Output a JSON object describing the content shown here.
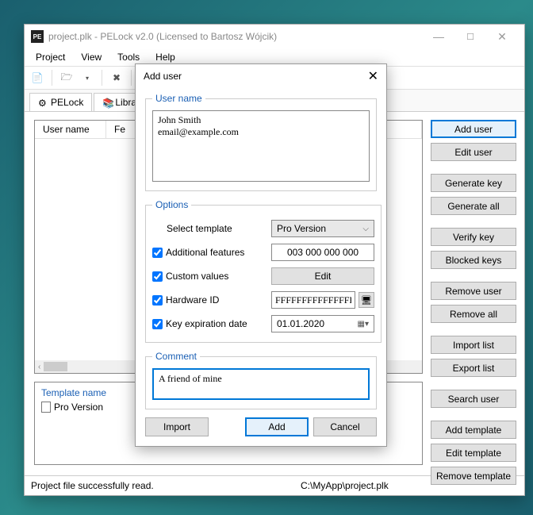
{
  "window": {
    "title": "project.plk - PELock v2.0 (Licensed to Bartosz Wójcik)"
  },
  "menu": {
    "project": "Project",
    "view": "View",
    "tools": "Tools",
    "help": "Help"
  },
  "tabs": {
    "pelock": "PELock",
    "library": "Libra"
  },
  "user_list": {
    "col_username": "User name",
    "col_features": "Fe"
  },
  "template_panel": {
    "header": "Template name",
    "item": "Pro Version"
  },
  "side": {
    "add_user": "Add user",
    "edit_user": "Edit user",
    "generate_key": "Generate key",
    "generate_all": "Generate all",
    "verify_key": "Verify key",
    "blocked_keys": "Blocked keys",
    "remove_user": "Remove user",
    "remove_all": "Remove all",
    "import_list": "Import list",
    "export_list": "Export list",
    "search_user": "Search user",
    "add_template": "Add template",
    "edit_template": "Edit template",
    "remove_template": "Remove template"
  },
  "status": {
    "msg": "Project file successfully read.",
    "path": "C:\\MyApp\\project.plk"
  },
  "modal": {
    "title": "Add user",
    "username_legend": "User name",
    "username_value": "John Smith\nemail@example.com",
    "options_legend": "Options",
    "select_template_label": "Select template",
    "select_template_value": "Pro Version",
    "additional_features_label": "Additional features",
    "additional_features_value": "003 000 000 000",
    "custom_values_label": "Custom values",
    "custom_values_btn": "Edit",
    "hardware_id_label": "Hardware ID",
    "hardware_id_value": "FFFFFFFFFFFFFFFF",
    "key_expiration_label": "Key expiration date",
    "key_expiration_value": "01.01.2020",
    "comment_legend": "Comment",
    "comment_value": "A friend of mine",
    "import_btn": "Import",
    "add_btn": "Add",
    "cancel_btn": "Cancel"
  }
}
